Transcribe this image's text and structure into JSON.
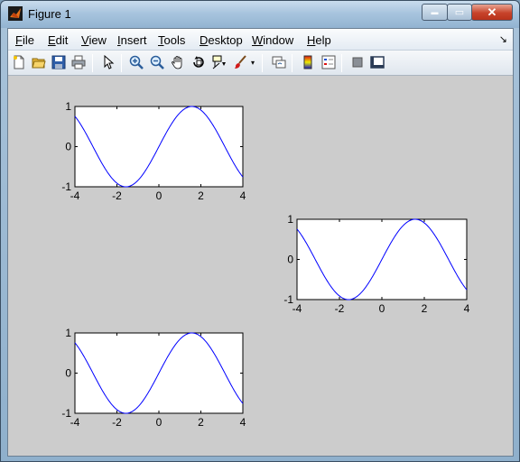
{
  "window": {
    "title": "Figure 1",
    "min_glyph": "▬",
    "max_glyph": "▭",
    "close_glyph": "✕"
  },
  "menu": [
    {
      "key": "File",
      "label": "File",
      "u": "F",
      "rest": "ile"
    },
    {
      "key": "Edit",
      "label": "Edit",
      "u": "E",
      "rest": "dit"
    },
    {
      "key": "View",
      "label": "View",
      "u": "V",
      "rest": "iew"
    },
    {
      "key": "Insert",
      "label": "Insert",
      "u": "I",
      "rest": "nsert"
    },
    {
      "key": "Tools",
      "label": "Tools",
      "u": "T",
      "rest": "ools"
    },
    {
      "key": "Desktop",
      "label": "Desktop",
      "u": "D",
      "rest": "esktop"
    },
    {
      "key": "Window",
      "label": "Window",
      "u": "W",
      "rest": "indow"
    },
    {
      "key": "Help",
      "label": "Help",
      "u": "H",
      "rest": "elp"
    }
  ],
  "menu_dock_glyph": "↘",
  "toolbar": [
    {
      "name": "new-figure-icon"
    },
    {
      "name": "open-file-icon"
    },
    {
      "name": "save-icon"
    },
    {
      "name": "print-icon"
    },
    {
      "name": "edit-plot-icon"
    },
    {
      "name": "zoom-in-icon"
    },
    {
      "name": "zoom-out-icon"
    },
    {
      "name": "pan-icon"
    },
    {
      "name": "rotate-3d-icon"
    },
    {
      "name": "data-cursor-icon"
    },
    {
      "name": "brush-icon"
    },
    {
      "name": "link-plot-icon"
    },
    {
      "name": "colorbar-icon"
    },
    {
      "name": "legend-icon"
    },
    {
      "name": "hide-plot-tools-icon"
    },
    {
      "name": "show-plot-tools-icon"
    }
  ],
  "colors": {
    "line": "#0000ff",
    "figure_bg": "#cccccc",
    "axes_bg": "#ffffff"
  },
  "chart_data": [
    {
      "type": "line",
      "function": "sin(x)",
      "x_range": [
        -4,
        4
      ],
      "xlim": [
        -4,
        4
      ],
      "ylim": [
        -1,
        1
      ],
      "xticks": [
        "-4",
        "-2",
        "0",
        "2",
        "4"
      ],
      "yticks": [
        "1",
        "0",
        "-1"
      ],
      "title": "",
      "xlabel": "",
      "ylabel": ""
    },
    {
      "type": "line",
      "function": "sin(x)",
      "x_range": [
        -4,
        4
      ],
      "xlim": [
        -4,
        4
      ],
      "ylim": [
        -1,
        1
      ],
      "xticks": [
        "-4",
        "-2",
        "0",
        "2",
        "4"
      ],
      "yticks": [
        "1",
        "0",
        "-1"
      ],
      "title": "",
      "xlabel": "",
      "ylabel": ""
    },
    {
      "type": "line",
      "function": "sin(x)",
      "x_range": [
        -4,
        4
      ],
      "xlim": [
        -4,
        4
      ],
      "ylim": [
        -1,
        1
      ],
      "xticks": [
        "-4",
        "-2",
        "0",
        "2",
        "4"
      ],
      "yticks": [
        "1",
        "0",
        "-1"
      ],
      "title": "",
      "xlabel": "",
      "ylabel": ""
    }
  ]
}
